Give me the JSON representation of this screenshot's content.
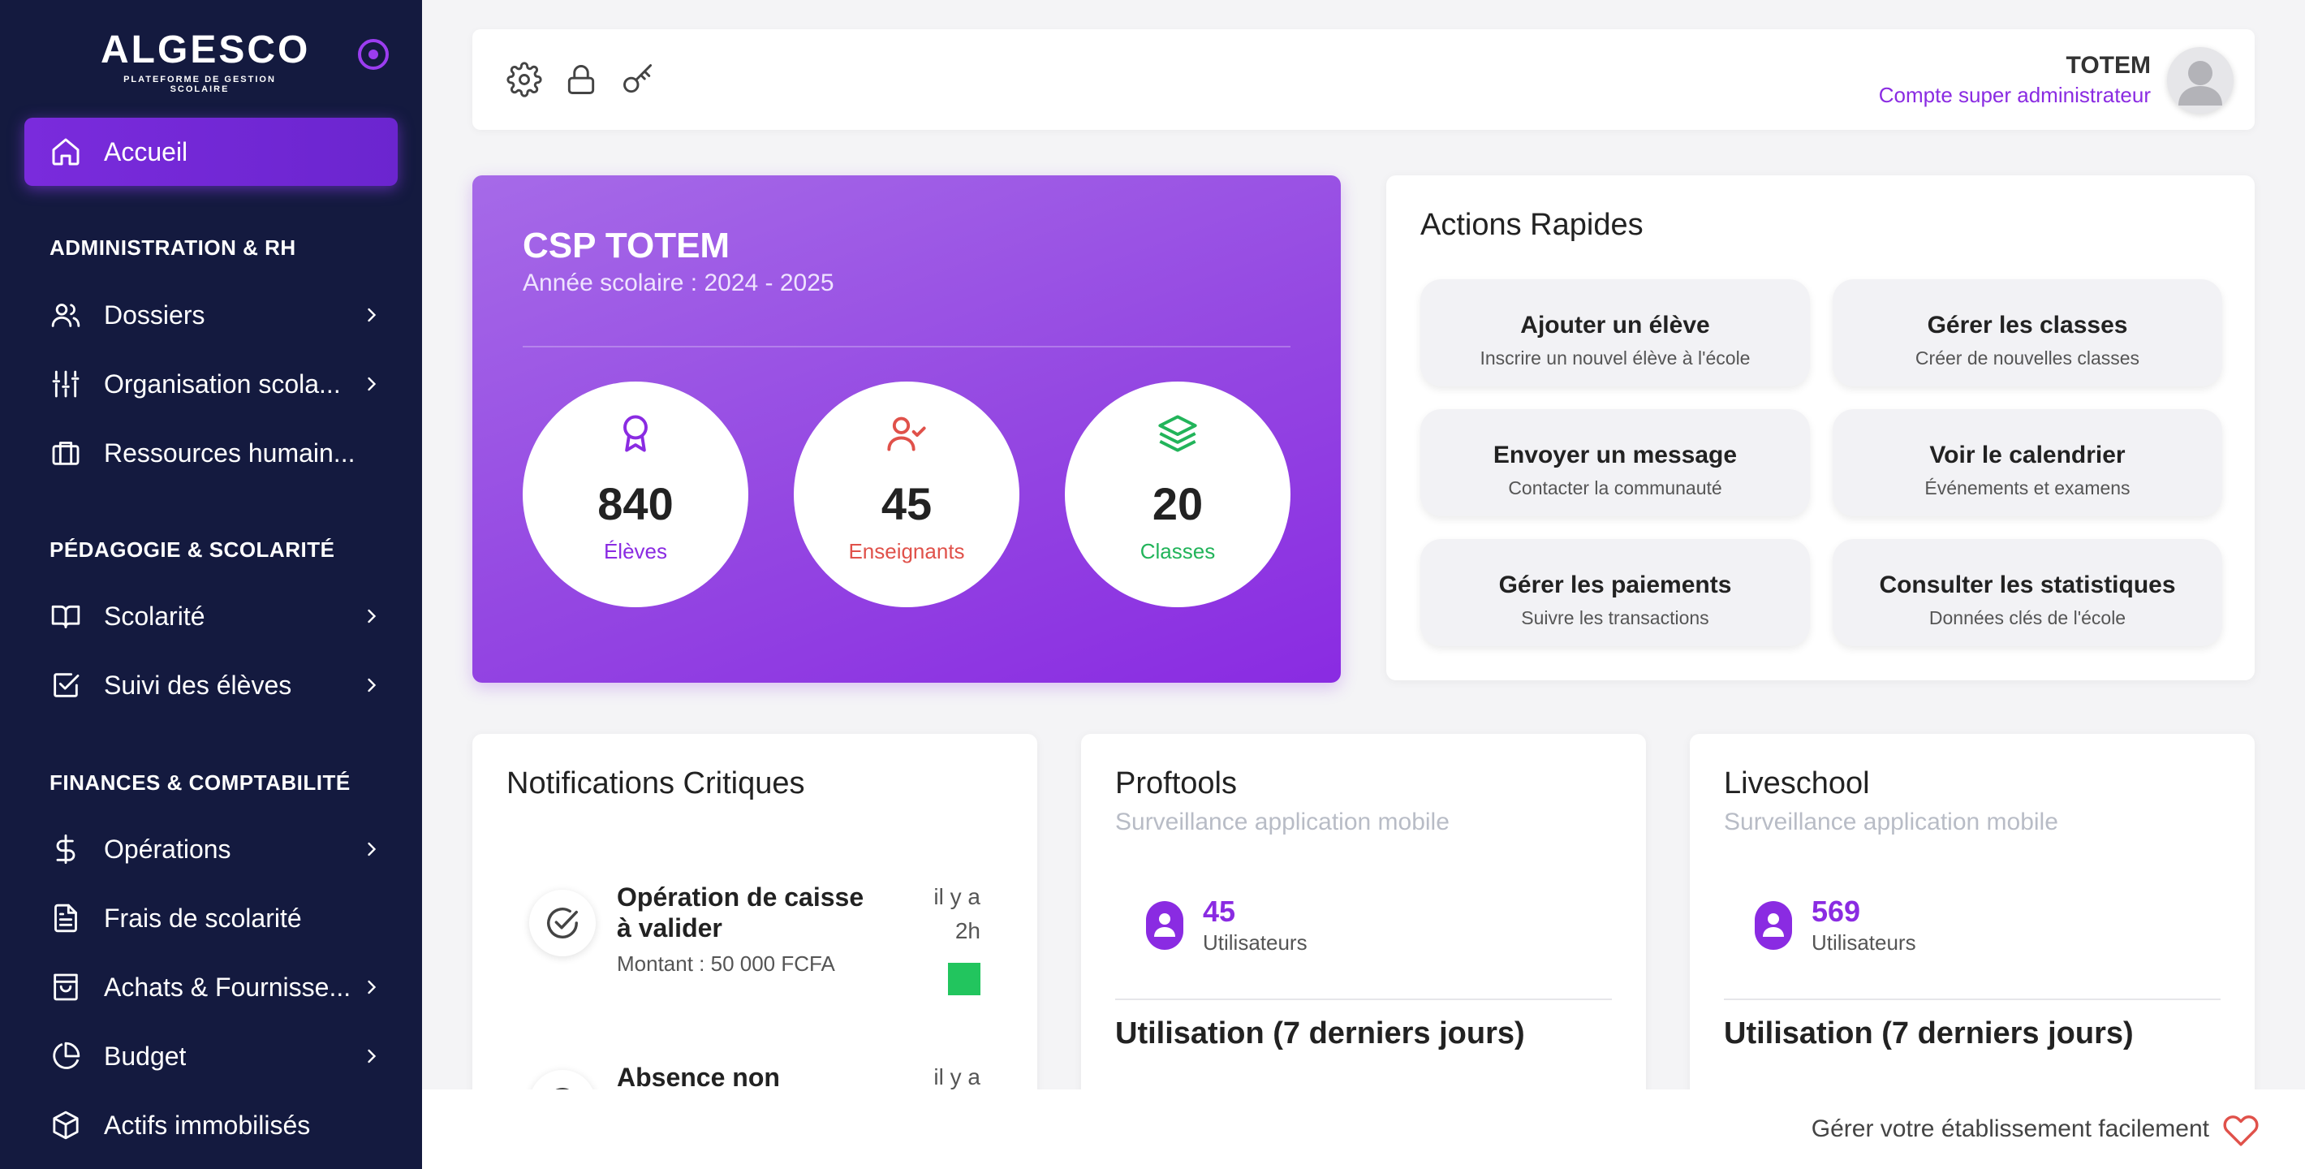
{
  "brand": {
    "name": "ALGESCO",
    "tagline": "PLATEFORME DE GESTION SCOLAIRE",
    "accent": "#8a2be2",
    "sidebar_bg": "#141a3f"
  },
  "sidebar": {
    "active": {
      "label": "Accueil",
      "icon": "home-icon"
    },
    "sections": [
      {
        "title": "ADMINISTRATION & RH",
        "items": [
          {
            "label": "Dossiers",
            "icon": "users-icon",
            "has_submenu": true
          },
          {
            "label": "Organisation scola...",
            "icon": "sliders-icon",
            "has_submenu": true
          },
          {
            "label": "Ressources humain...",
            "icon": "briefcase-icon",
            "has_submenu": false
          }
        ]
      },
      {
        "title": "PÉDAGOGIE & SCOLARITÉ",
        "items": [
          {
            "label": "Scolarité",
            "icon": "book-icon",
            "has_submenu": true
          },
          {
            "label": "Suivi des élèves",
            "icon": "checkbox-icon",
            "has_submenu": true
          }
        ]
      },
      {
        "title": "FINANCES & COMPTABILITÉ",
        "items": [
          {
            "label": "Opérations",
            "icon": "dollar-icon",
            "has_submenu": true
          },
          {
            "label": "Frais de scolarité",
            "icon": "document-icon",
            "has_submenu": false
          },
          {
            "label": "Achats & Fournisse...",
            "icon": "shopping-bag-icon",
            "has_submenu": true
          },
          {
            "label": "Budget",
            "icon": "pie-chart-icon",
            "has_submenu": true
          },
          {
            "label": "Actifs immobilisés",
            "icon": "box-icon",
            "has_submenu": false
          }
        ]
      }
    ]
  },
  "topbar": {
    "icons": [
      "gear-icon",
      "lock-icon",
      "key-icon"
    ],
    "user_name": "TOTEM",
    "user_role": "Compte super administrateur"
  },
  "school": {
    "name": "CSP TOTEM",
    "year": "Année scolaire : 2024 - 2025",
    "stats": [
      {
        "value": "840",
        "label": "Élèves",
        "color": "#8a2be2",
        "icon": "award-icon"
      },
      {
        "value": "45",
        "label": "Enseignants",
        "color": "#e0514a",
        "icon": "user-check-icon"
      },
      {
        "value": "20",
        "label": "Classes",
        "color": "#22b45a",
        "icon": "layers-icon"
      }
    ]
  },
  "actions": {
    "title": "Actions Rapides",
    "items": [
      {
        "title": "Ajouter un élève",
        "sub": "Inscrire un nouvel élève à l'école"
      },
      {
        "title": "Gérer les classes",
        "sub": "Créer de nouvelles classes"
      },
      {
        "title": "Envoyer un message",
        "sub": "Contacter la communauté"
      },
      {
        "title": "Voir le calendrier",
        "sub": "Événements et examens"
      },
      {
        "title": "Gérer les paiements",
        "sub": "Suivre les transactions"
      },
      {
        "title": "Consulter les statistiques",
        "sub": "Données clés de l'école"
      }
    ]
  },
  "notifications": {
    "title": "Notifications Critiques",
    "items": [
      {
        "title_l1": "Opération de caisse",
        "title_l2": "à valider",
        "desc": "Montant : 50 000 FCFA",
        "time_l1": "il y a",
        "time_l2": "2h",
        "flag_color": "#22c55e"
      },
      {
        "title_l1": "Absence non",
        "time_l1": "il y a"
      }
    ]
  },
  "apps": [
    {
      "name": "Proftools",
      "sub": "Surveillance application mobile",
      "users": "45",
      "users_label": "Utilisateurs",
      "usage_title": "Utilisation (7 derniers jours)"
    },
    {
      "name": "Liveschool",
      "sub": "Surveillance application mobile",
      "users": "569",
      "users_label": "Utilisateurs",
      "usage_title": "Utilisation (7 derniers jours)"
    }
  ],
  "footer": {
    "text": "Gérer votre établissement facilement",
    "icon": "heart-icon"
  }
}
